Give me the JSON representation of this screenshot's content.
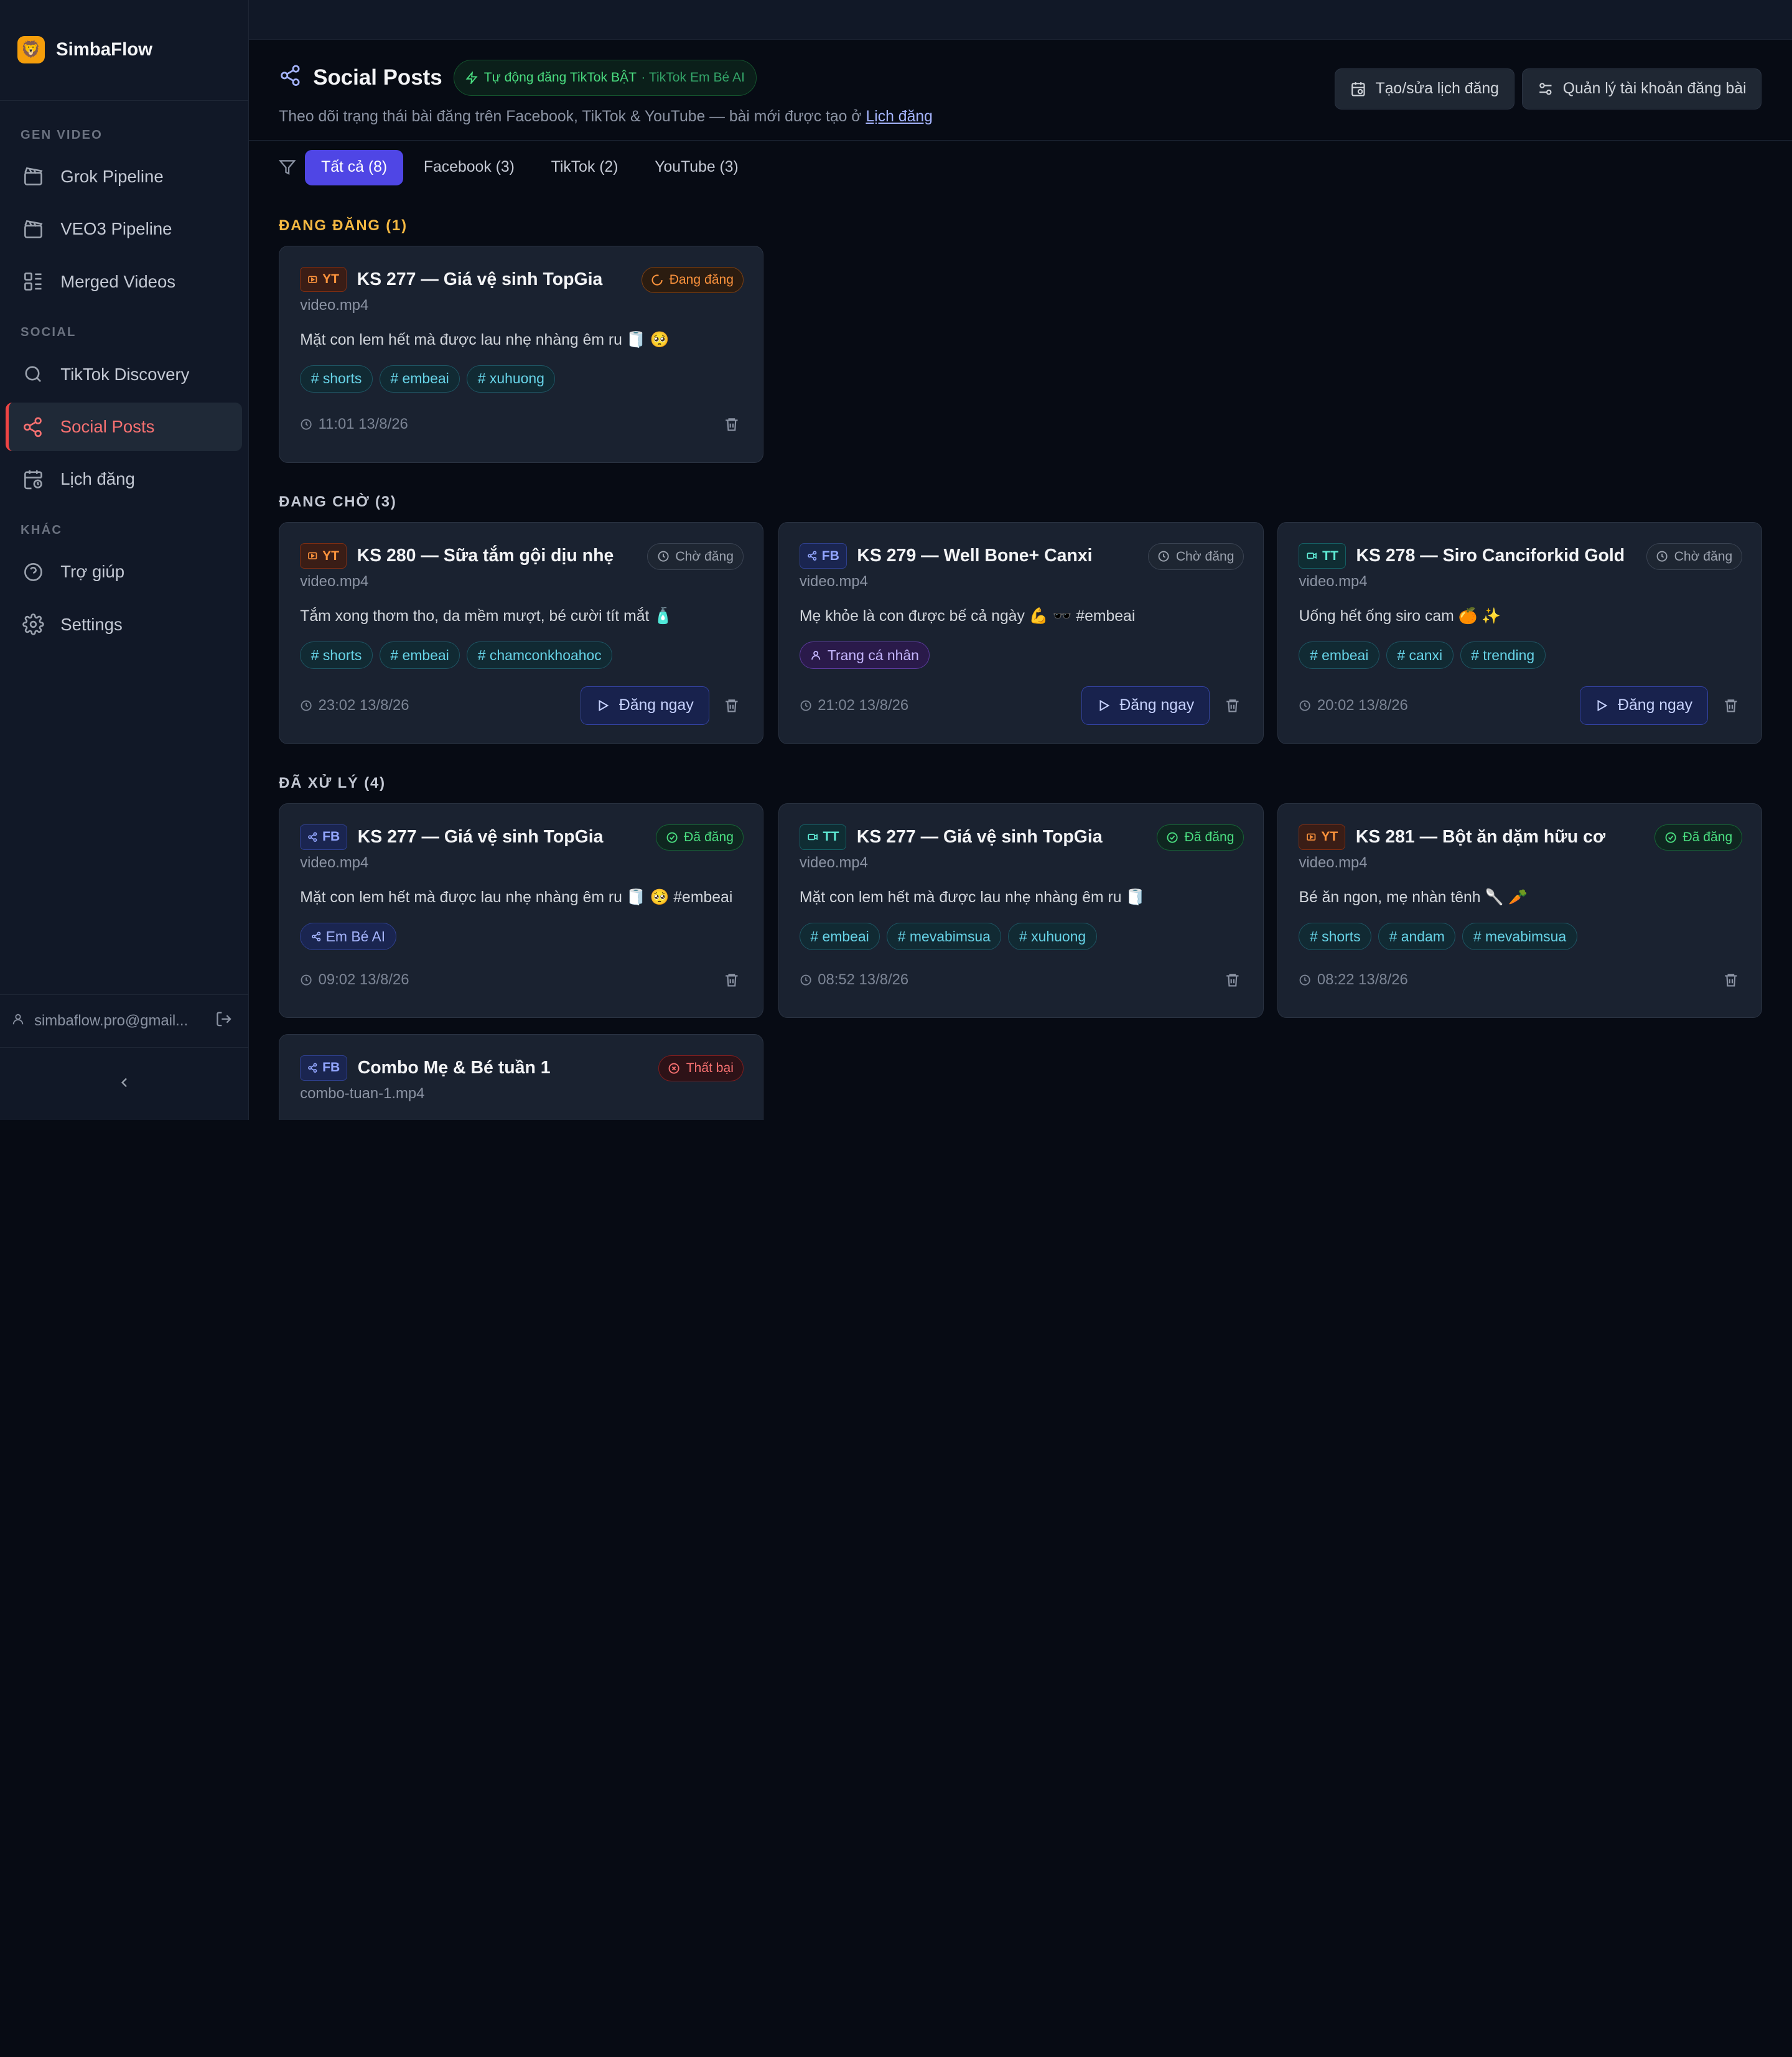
{
  "app": {
    "name": "SimbaFlow",
    "logo_emoji": "🦁"
  },
  "sidebar": {
    "sections": [
      {
        "label": "GEN VIDEO"
      },
      {
        "label": "SOCIAL"
      },
      {
        "label": "KHÁC"
      }
    ],
    "items": [
      {
        "label": "Grok Pipeline",
        "icon": "clapperboard-icon"
      },
      {
        "label": "VEO3 Pipeline",
        "icon": "clapperboard-icon"
      },
      {
        "label": "Merged Videos",
        "icon": "merge-icon"
      },
      {
        "label": "TikTok Discovery",
        "icon": "search-icon"
      },
      {
        "label": "Social Posts",
        "icon": "share-icon",
        "active": true
      },
      {
        "label": "Lịch đăng",
        "icon": "calendar-clock-icon"
      },
      {
        "label": "Trợ giúp",
        "icon": "help-icon"
      },
      {
        "label": "Settings",
        "icon": "gear-icon"
      }
    ],
    "user_email": "simbaflow.pro@gmail..."
  },
  "header": {
    "title": "Social Posts",
    "auto_badge": "Tự động đăng TikTok BẬT",
    "auto_badge_sub": "· TikTok Em Bé AI",
    "subtitle": "Theo dõi trạng thái bài đăng trên Facebook, TikTok & YouTube — bài mới được tạo ở",
    "subtitle_link": "Lịch đăng",
    "btn_schedule": "Tạo/sửa lịch đăng",
    "btn_accounts": "Quản lý tài khoản đăng bài"
  },
  "filters": {
    "tabs": [
      {
        "label": "Tất cả (8)",
        "active": true
      },
      {
        "label": "Facebook (3)"
      },
      {
        "label": "TikTok (2)"
      },
      {
        "label": "YouTube (3)"
      }
    ]
  },
  "sections": {
    "posting": {
      "title": "ĐANG ĐĂNG (1)",
      "color": "#f5b942"
    },
    "waiting": {
      "title": "ĐANG CHỜ (3)",
      "color": "#c4c9d4"
    },
    "processed": {
      "title": "ĐÃ XỬ LÝ (4)",
      "color": "#c4c9d4"
    }
  },
  "post_now_label": "Đăng ngay",
  "cards": [
    {
      "platform": "YT",
      "title": "KS 277 — Giá vệ sinh TopGia",
      "status": "Đang đăng",
      "file": "video.mp4",
      "caption": "Mặt con lem hết mà được lau nhẹ nhàng êm ru 🧻 🥺",
      "tags": [
        "# shorts",
        "# embeai",
        "# xuhuong"
      ],
      "time": "11:01 13/8/26"
    },
    {
      "platform": "YT",
      "title": "KS 280 — Sữa tắm gội dịu nhẹ",
      "status": "Chờ đăng",
      "file": "video.mp4",
      "caption": "Tắm xong thơm tho, da mềm mượt, bé cười tít mắt 🧴",
      "tags": [
        "# shorts",
        "# embeai",
        "# chamconkhoahoc"
      ],
      "time": "23:02 13/8/26"
    },
    {
      "platform": "FB",
      "title": "KS 279 — Well Bone+ Canxi",
      "status": "Chờ đăng",
      "file": "video.mp4",
      "caption": "Mẹ khỏe là con được bế cả ngày 💪 🕶️  #embeai",
      "tags": [
        "Trang cá nhân"
      ],
      "time": "21:02 13/8/26"
    },
    {
      "platform": "TT",
      "title": "KS 278 — Siro Canciforkid Gold",
      "status": "Chờ đăng",
      "file": "video.mp4",
      "caption": "Uống hết ống siro cam 🍊 ✨",
      "tags": [
        "# embeai",
        "# canxi",
        "# trending"
      ],
      "time": "20:02 13/8/26"
    },
    {
      "platform": "FB",
      "title": "KS 277 — Giá vệ sinh TopGia",
      "status": "Đã đăng",
      "file": "video.mp4",
      "caption": "Mặt con lem hết mà được lau nhẹ nhàng êm ru 🧻 🥺  #embeai",
      "tags": [
        "Em Bé AI"
      ],
      "time": "09:02 13/8/26"
    },
    {
      "platform": "TT",
      "title": "KS 277 — Giá vệ sinh TopGia",
      "status": "Đã đăng",
      "file": "video.mp4",
      "caption": "Mặt con lem hết mà được lau nhẹ nhàng êm ru 🧻",
      "tags": [
        "# embeai",
        "# mevabimsua",
        "# xuhuong"
      ],
      "time": "08:52 13/8/26"
    },
    {
      "platform": "YT",
      "title": "KS 281 — Bột ăn dặm hữu cơ",
      "status": "Đã đăng",
      "file": "video.mp4",
      "caption": "Bé ăn ngon, mẹ nhàn tênh 🥄 🥕",
      "tags": [
        "# shorts",
        "# andam",
        "# mevabimsua"
      ],
      "time": "08:22 13/8/26"
    },
    {
      "platform": "FB",
      "title": "Combo Mẹ & Bé tuần 1",
      "status": "Thất bại",
      "file": "combo-tuan-1.mp4"
    }
  ]
}
